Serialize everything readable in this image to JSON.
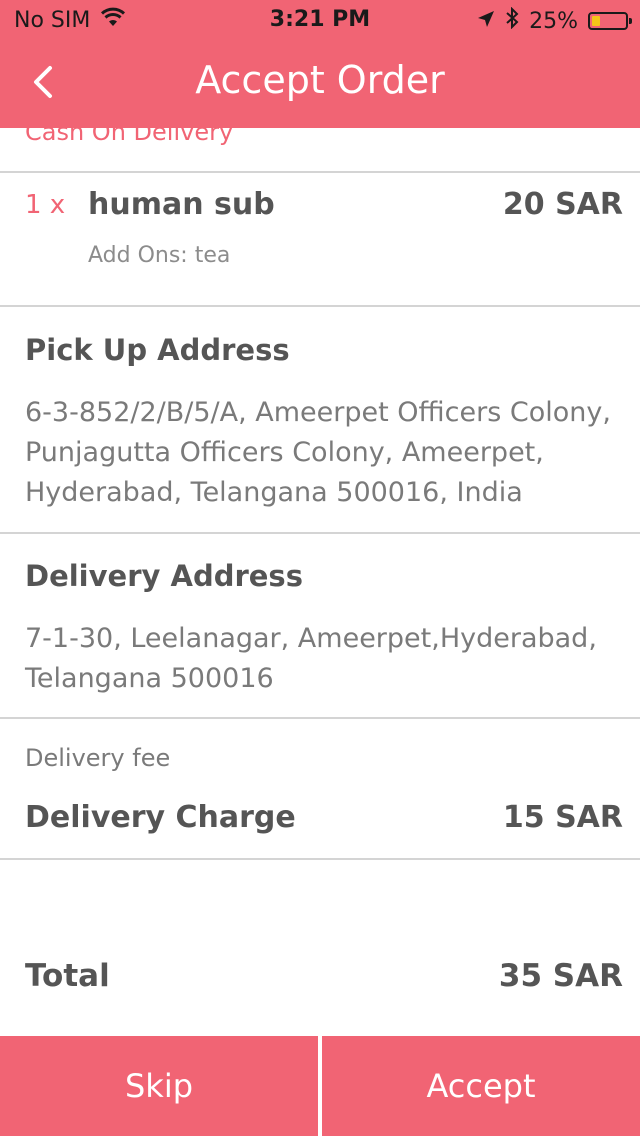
{
  "status_bar": {
    "carrier": "No SIM",
    "time": "3:21 PM",
    "battery": "25%",
    "battery_level": 0.25
  },
  "nav": {
    "title": "Accept Order",
    "back_icon": "chevron-left-icon"
  },
  "order": {
    "payment_method": "Cash On Delivery",
    "items": [
      {
        "quantity": "1 x",
        "name": "human sub",
        "price": "20 SAR",
        "addons": "Add Ons: tea"
      }
    ]
  },
  "pickup": {
    "title": "Pick Up Address",
    "address": "6-3-852/2/B/5/A, Ameerpet Officers Colony, Punjagutta Officers Colony, Ameerpet, Hyderabad, Telangana 500016, India"
  },
  "delivery": {
    "title": "Delivery Address",
    "address": "7-1-30, Leelanagar, Ameerpet,Hyderabad, Telangana 500016"
  },
  "fees": {
    "section_label": "Delivery fee",
    "charge_label": "Delivery Charge",
    "charge_value": "15 SAR"
  },
  "total": {
    "label": "Total",
    "value": "35 SAR"
  },
  "actions": {
    "skip_label": "Skip",
    "accept_label": "Accept"
  },
  "colors": {
    "accent": "#f16474",
    "divider": "#d4d4d4",
    "text": "#555555",
    "muted": "#7a7a7a"
  }
}
